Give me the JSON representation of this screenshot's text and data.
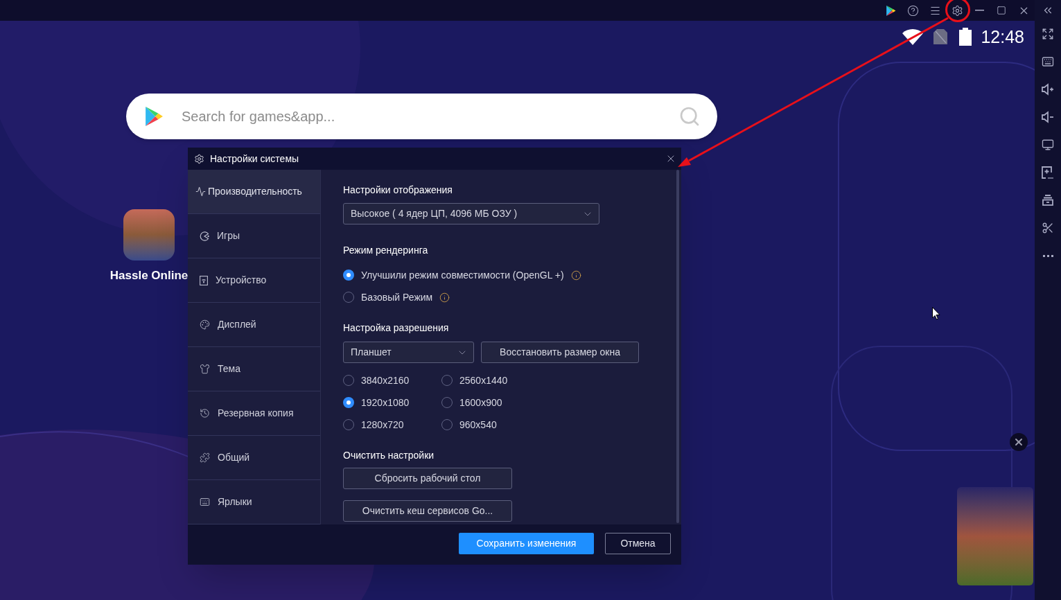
{
  "status_bar": {
    "time": "12:48"
  },
  "search": {
    "placeholder": "Search for games&app..."
  },
  "desktop_apps": [
    {
      "label": "Hassle Online"
    }
  ],
  "dialog": {
    "title": "Настройки системы",
    "nav": [
      {
        "label": "Производительность",
        "selected": true
      },
      {
        "label": "Игры",
        "selected": false
      },
      {
        "label": "Устройство",
        "selected": false
      },
      {
        "label": "Дисплей",
        "selected": false
      },
      {
        "label": "Тема",
        "selected": false
      },
      {
        "label": "Резервная копия",
        "selected": false
      },
      {
        "label": "Общий",
        "selected": false
      },
      {
        "label": "Ярлыки",
        "selected": false
      }
    ],
    "display": {
      "heading": "Настройки отображения",
      "value": "Высокое ( 4 ядер ЦП, 4096 МБ ОЗУ )"
    },
    "rendering": {
      "heading": "Режим рендеринга",
      "options": [
        {
          "label": "Улучшили режим совместимости (OpenGL +)",
          "selected": true
        },
        {
          "label": "Базовый Режим",
          "selected": false
        }
      ]
    },
    "resolution": {
      "heading": "Настройка разрешения",
      "preset": "Планшет",
      "restore_button": "Восстановить размер окна",
      "options": [
        {
          "label": "3840x2160",
          "selected": false
        },
        {
          "label": "2560x1440",
          "selected": false
        },
        {
          "label": "1920x1080",
          "selected": true
        },
        {
          "label": "1600x900",
          "selected": false
        },
        {
          "label": "1280x720",
          "selected": false
        },
        {
          "label": "960x540",
          "selected": false
        }
      ]
    },
    "reset": {
      "heading": "Очистить настройки",
      "buttons": [
        "Сбросить рабочий стол",
        "Очистить кеш сервисов Go..."
      ]
    },
    "footer_buttons": [
      {
        "label": "Сохранить изменения",
        "kind": "primary"
      },
      {
        "label": "Отмена",
        "kind": "secondary"
      }
    ]
  }
}
